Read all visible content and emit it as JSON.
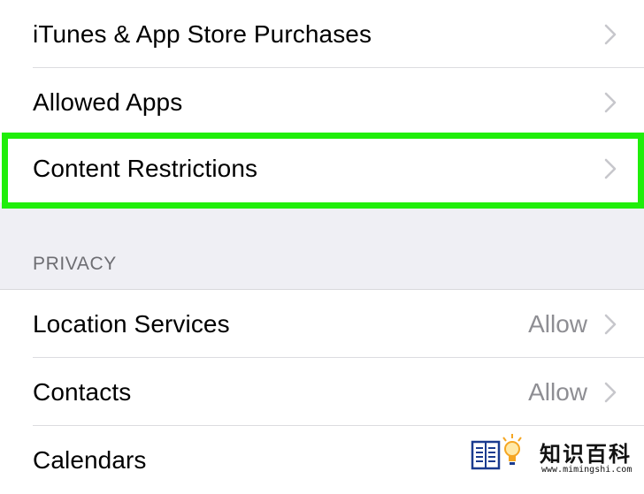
{
  "restrictions": {
    "rows": [
      {
        "label": "iTunes & App Store Purchases"
      },
      {
        "label": "Allowed Apps"
      },
      {
        "label": "Content Restrictions",
        "highlighted": true
      }
    ]
  },
  "privacy": {
    "header": "PRIVACY",
    "rows": [
      {
        "label": "Location Services",
        "value": "Allow"
      },
      {
        "label": "Contacts",
        "value": "Allow"
      },
      {
        "label": "Calendars"
      }
    ]
  },
  "watermark": {
    "title": "知识百科",
    "url": "www.mimingshi.com"
  },
  "icons": {
    "chevron": "chevron-right-icon",
    "book": "book-icon",
    "bulb": "lightbulb-icon"
  },
  "colors": {
    "highlight": "#20ee0a",
    "grouped_background": "#efeff4",
    "secondary_text": "#8e8e93",
    "chevron": "#c7c7cc"
  }
}
